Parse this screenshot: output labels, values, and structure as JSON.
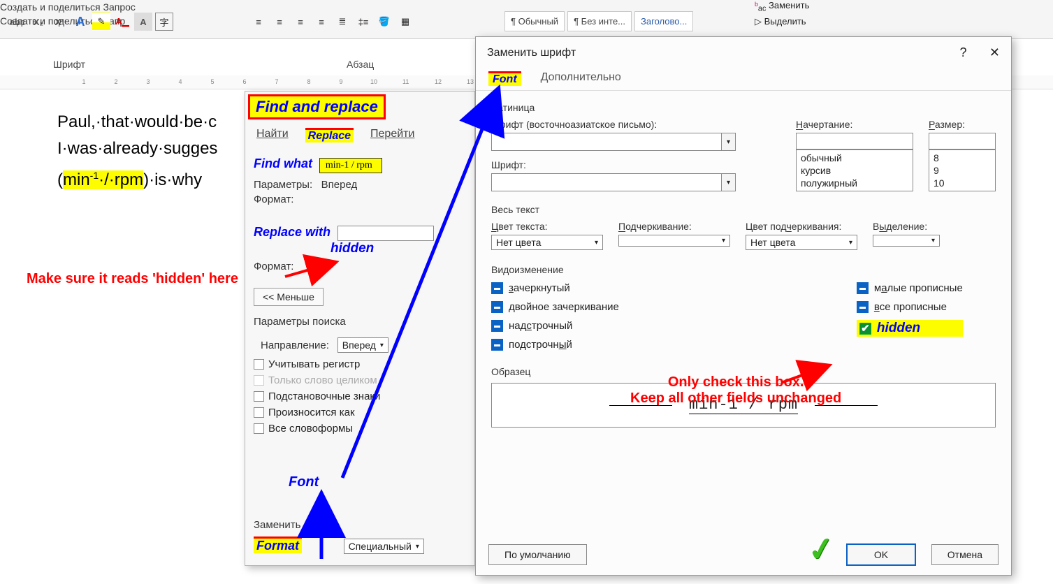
{
  "ribbon": {
    "group_font_label": "Шрифт",
    "group_para_label": "Абзац",
    "styles": {
      "normal": "¶ Обычный",
      "nointerval": "¶ Без инте...",
      "heading": "Заголово..."
    },
    "editing": {
      "replace": "Заменить",
      "select": "Выделить"
    },
    "share": {
      "line1": "Создать и поделиться Запрос",
      "line2": "Создать и поделиться Запр"
    }
  },
  "ruler": {
    "marks": [
      "",
      "1",
      "2",
      "3",
      "4",
      "5",
      "6",
      "7",
      "8",
      "9",
      "10",
      "11",
      "12",
      "13"
    ]
  },
  "doc": {
    "line1": "Paul,·that·would·be·c",
    "line2": "I·was·already·sugges",
    "line3a": "(",
    "line3_hl": "min⁻¹·/·rpm",
    "line3b": ")·is·why"
  },
  "dlg1": {
    "title": "Find and replace",
    "tab_find": "Найти",
    "tab_replace": "Replace",
    "tab_goto": "Перейти",
    "find_lbl": "Find what",
    "find_val": "min-1 / rpm",
    "params_lbl": "Параметры:",
    "params_val": "Вперед",
    "format_lbl": "Формат:",
    "replace_lbl": "Replace with",
    "hidden_lbl": "hidden",
    "less_btn": "<< Меньше",
    "search_params": "Параметры поиска",
    "dir_lbl": "Направление:",
    "dir_val": "Вперед",
    "chk_case": "Учитывать регистр",
    "chk_whole": "Только слово целиком",
    "chk_wild": "Подстановочные знаки",
    "chk_sounds": "Произносится как",
    "chk_forms": "Все словоформы",
    "font_note": "Font",
    "replace_section": "Заменить",
    "format_btn": "Format",
    "special_btn": "Специальный"
  },
  "dlg2": {
    "title": "Заменить шрифт",
    "help": "?",
    "tab_font": "Font",
    "tab_adv": "Дополнительно",
    "grp_latin": "Латиница",
    "lbl_asian": "Шрифт (восточноазиатское письмо):",
    "lbl_font": "Шрифт:",
    "lbl_style": "Начертание:",
    "lbl_size": "Размер:",
    "styles": [
      "обычный",
      "курсив",
      "полужирный"
    ],
    "sizes": [
      "8",
      "9",
      "10"
    ],
    "grp_alltext": "Весь текст",
    "lbl_color": "Цвет текста:",
    "lbl_under": "Подчеркивание:",
    "lbl_ucolor": "Цвет подчеркивания:",
    "lbl_hilite": "Выделение:",
    "nocolor": "Нет цвета",
    "grp_effects": "Видоизменение",
    "eff_strike": "зачеркнутый",
    "eff_dstrike": "двойное зачеркивание",
    "eff_super": "надстрочный",
    "eff_sub": "подстрочный",
    "eff_smallcaps": "малые прописные",
    "eff_allcaps": "все прописные",
    "eff_hidden": "hidden",
    "grp_sample": "Образец",
    "sample_text": "min-1 / rpm",
    "btn_default": "По умолчанию",
    "btn_ok": "OK",
    "btn_cancel": "Отмена"
  },
  "anno": {
    "hidden_note": "Make sure it reads 'hidden' here",
    "only_check1": "Only check this box.",
    "only_check2": "Keep all other fields unchanged"
  }
}
